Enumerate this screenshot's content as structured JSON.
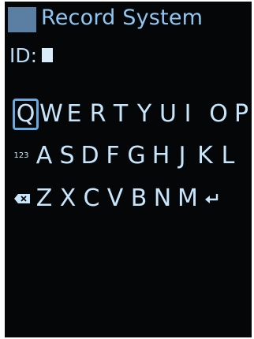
{
  "header": {
    "title": "Record System",
    "icon": "app-icon"
  },
  "form": {
    "id_label": "ID:",
    "id_value": ""
  },
  "keyboard": {
    "selected_key": "Q",
    "row1": [
      "Q",
      "W",
      "E",
      "R",
      "T",
      "Y",
      "U",
      "I",
      "O",
      "P"
    ],
    "row2": [
      "123",
      "A",
      "S",
      "D",
      "F",
      "G",
      "H",
      "J",
      "K",
      "L"
    ],
    "row3": [
      "backspace",
      "Z",
      "X",
      "C",
      "V",
      "B",
      "N",
      "M",
      "enter"
    ],
    "backspace_icon": "backspace-icon",
    "enter_icon": "enter-icon",
    "accent_color": "#6aa8de",
    "text_color": "#c8e6fb",
    "background_color": "#050608"
  }
}
